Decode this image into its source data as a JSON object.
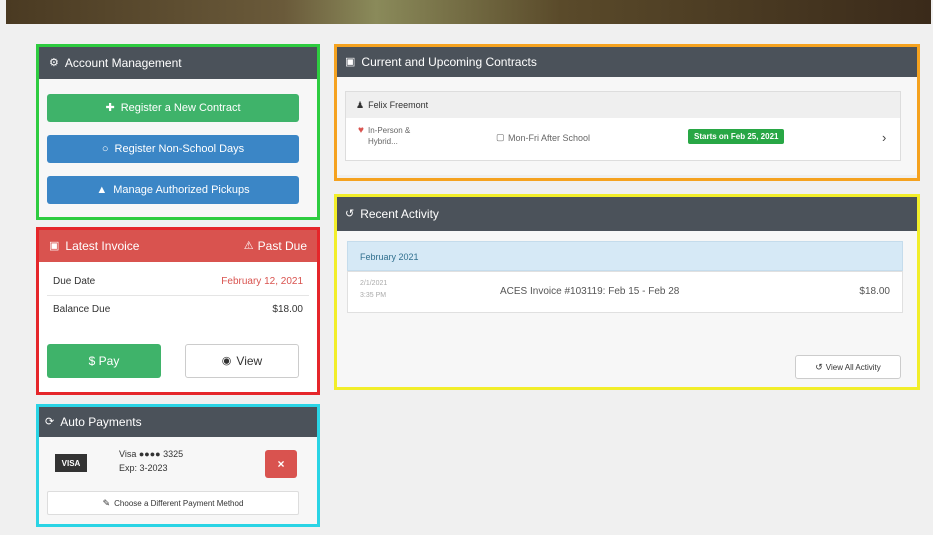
{
  "account": {
    "title": "Account Management",
    "btn1": "Register a New Contract",
    "btn2": "Register Non-School Days",
    "btn3": "Manage Authorized Pickups"
  },
  "invoice": {
    "title": "Latest Invoice",
    "status": "Past Due",
    "due_label": "Due Date",
    "due_value": "February 12, 2021",
    "balance_label": "Balance Due",
    "balance_value": "$18.00",
    "pay_label": "$ Pay",
    "view_label": "View"
  },
  "auto": {
    "title": "Auto Payments",
    "card_brand": "VISA",
    "card_masked": "Visa ●●●● 3325",
    "card_exp": "Exp: 3-2023",
    "remove": "×",
    "choose": "Choose a Different Payment Method"
  },
  "contracts": {
    "title": "Current and Upcoming Contracts",
    "child": "Felix Freemont",
    "location": "In-Person & Hybrid...",
    "schedule": "Mon-Fri After School",
    "start_badge": "Starts on Feb 25, 2021"
  },
  "activity": {
    "title": "Recent Activity",
    "month": "February 2021",
    "items": [
      {
        "date": "2/1/2021",
        "time": "3:35 PM",
        "desc": "ACES Invoice #103119: Feb 15 - Feb 28",
        "amount": "$18.00"
      }
    ],
    "view_all": "View All Activity"
  },
  "colors": {
    "green_box": "#2ecc40",
    "red_box": "#e5262a",
    "cyan_box": "#2ad4e5",
    "orange_box": "#f5a21f",
    "yellow_box": "#f2ee2a"
  }
}
